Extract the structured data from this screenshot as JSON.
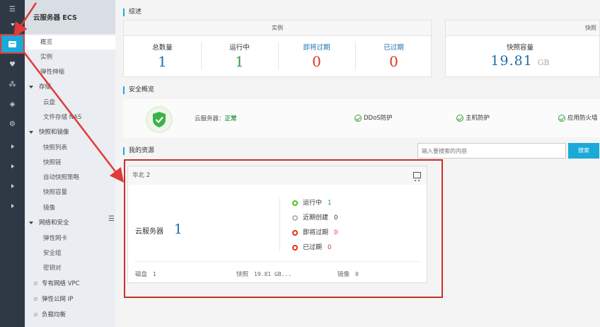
{
  "sidemenu": {
    "title": "云服务器 ECS",
    "items": [
      {
        "label": "概览"
      },
      {
        "label": "实例"
      },
      {
        "label": "弹性伸缩"
      },
      {
        "label": "存储"
      },
      {
        "label": "云盘"
      },
      {
        "label": "文件存储 NAS"
      },
      {
        "label": "快照和镜像"
      },
      {
        "label": "快照列表"
      },
      {
        "label": "快照链"
      },
      {
        "label": "自动快照策略"
      },
      {
        "label": "快照容量"
      },
      {
        "label": "镜像"
      },
      {
        "label": "网络和安全"
      },
      {
        "label": "弹性网卡"
      },
      {
        "label": "安全组"
      },
      {
        "label": "密钥对"
      },
      {
        "label": "专有网络 VPC"
      },
      {
        "label": "弹性公网 IP"
      },
      {
        "label": "负载均衡"
      }
    ]
  },
  "overview": {
    "title": "综述",
    "instances": {
      "header": "实例",
      "cols": [
        {
          "label": "总数量",
          "value": "1",
          "color": "#1a6fb0"
        },
        {
          "label": "运行中",
          "value": "1",
          "color": "#2e9c4a"
        },
        {
          "label": "即将过期",
          "value": "0",
          "color": "#d9372b"
        },
        {
          "label": "已过期",
          "value": "0",
          "color": "#d9372b"
        }
      ]
    },
    "snapshots": {
      "header": "快照",
      "label": "快照容量",
      "value": "19.81",
      "unit": "GB"
    }
  },
  "security": {
    "title": "安全概览",
    "server_label": "云服务器：",
    "server_status": "正常",
    "items": [
      "DDoS防护",
      "主机防护",
      "应用防火墙"
    ]
  },
  "resources": {
    "title": "我的资源",
    "search_placeholder": "输入要搜索的内容",
    "search_button": "搜索",
    "region": "华北 2",
    "server_label": "云服务器",
    "server_count": "1",
    "statuses": [
      {
        "label": "运行中",
        "count": "1",
        "color": "#52c41a"
      },
      {
        "label": "近期创建",
        "count": "0",
        "color": "#b3b3b3"
      },
      {
        "label": "即将过期",
        "count": "0",
        "color": "#e0301e"
      },
      {
        "label": "已过期",
        "count": "0",
        "color": "#e0301e"
      }
    ],
    "footer": [
      {
        "label": "磁盘",
        "value": "1"
      },
      {
        "label": "快照",
        "value": "19.81 GB..."
      },
      {
        "label": "镜像",
        "value": "0"
      }
    ]
  },
  "colors": {
    "accent": "#1aa9d8",
    "annotation": "#c9302c"
  }
}
